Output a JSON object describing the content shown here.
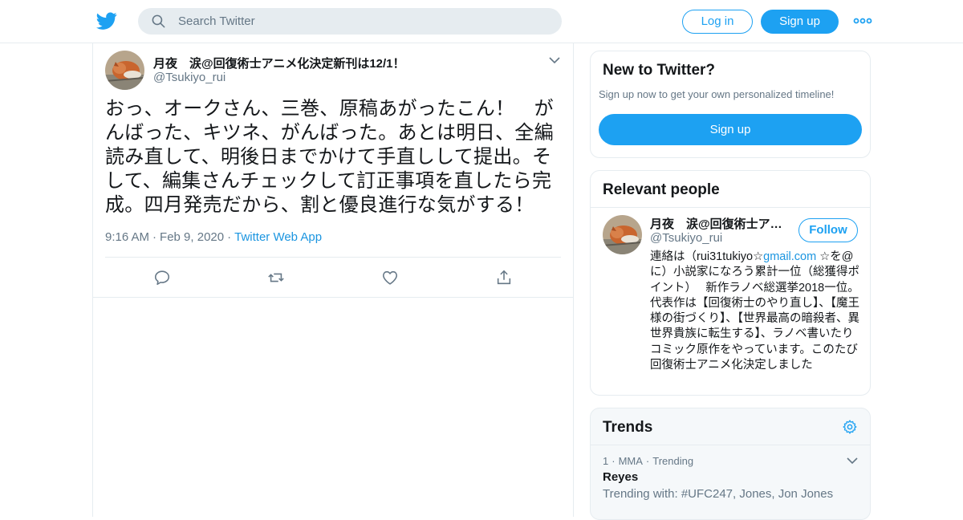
{
  "header": {
    "search_placeholder": "Search Twitter",
    "login_label": "Log in",
    "signup_label": "Sign up",
    "brand_color": "#1da1f2"
  },
  "tweet": {
    "author_name": "月夜　涙@回復術士アニメ化決定新刊は12/1！",
    "author_handle": "@Tsukiyo_rui",
    "text": "おっ、オークさん、三巻、原稿あがったこん！　がんばった、キツネ、がんばった。あとは明日、全編読み直して、明後日までかけて手直しして提出。そして、編集さんチェックして訂正事項を直したら完成。四月発売だから、割と優良進行な気がする！",
    "time": "9:16 AM",
    "date": "Feb 9, 2020",
    "separator": "·",
    "source": "Twitter Web App",
    "actions": [
      "reply-icon",
      "retweet-icon",
      "like-icon",
      "share-icon"
    ]
  },
  "sidebar": {
    "new_to_twitter": {
      "title": "New to Twitter?",
      "subtitle": "Sign up now to get your own personalized timeline!",
      "button_label": "Sign up"
    },
    "relevant_people": {
      "title": "Relevant people",
      "person": {
        "name": "月夜　涙@回復術士ア…",
        "handle": "@Tsukiyo_rui",
        "follow_label": "Follow",
        "bio_prefix": "連絡は（rui31tukiyo☆",
        "bio_link": "gmail.com",
        "bio_suffix": " ☆を@に）小説家になろう累計一位（総獲得ポイント）　 新作ラノベ総選挙2018一位。代表作は【回復術士のやり直し】、【魔王様の街づくり】、【世界最高の暗殺者、異世界貴族に転生する】、ラノベ書いたりコミック原作をやっています。このたび回復術士アニメ化決定しました"
      }
    },
    "trends": {
      "title": "Trends",
      "items": [
        {
          "rank": "1",
          "category": "MMA",
          "status": "Trending",
          "name": "Reyes",
          "trending_with": "Trending with: #UFC247, Jones, Jon Jones"
        }
      ]
    }
  }
}
